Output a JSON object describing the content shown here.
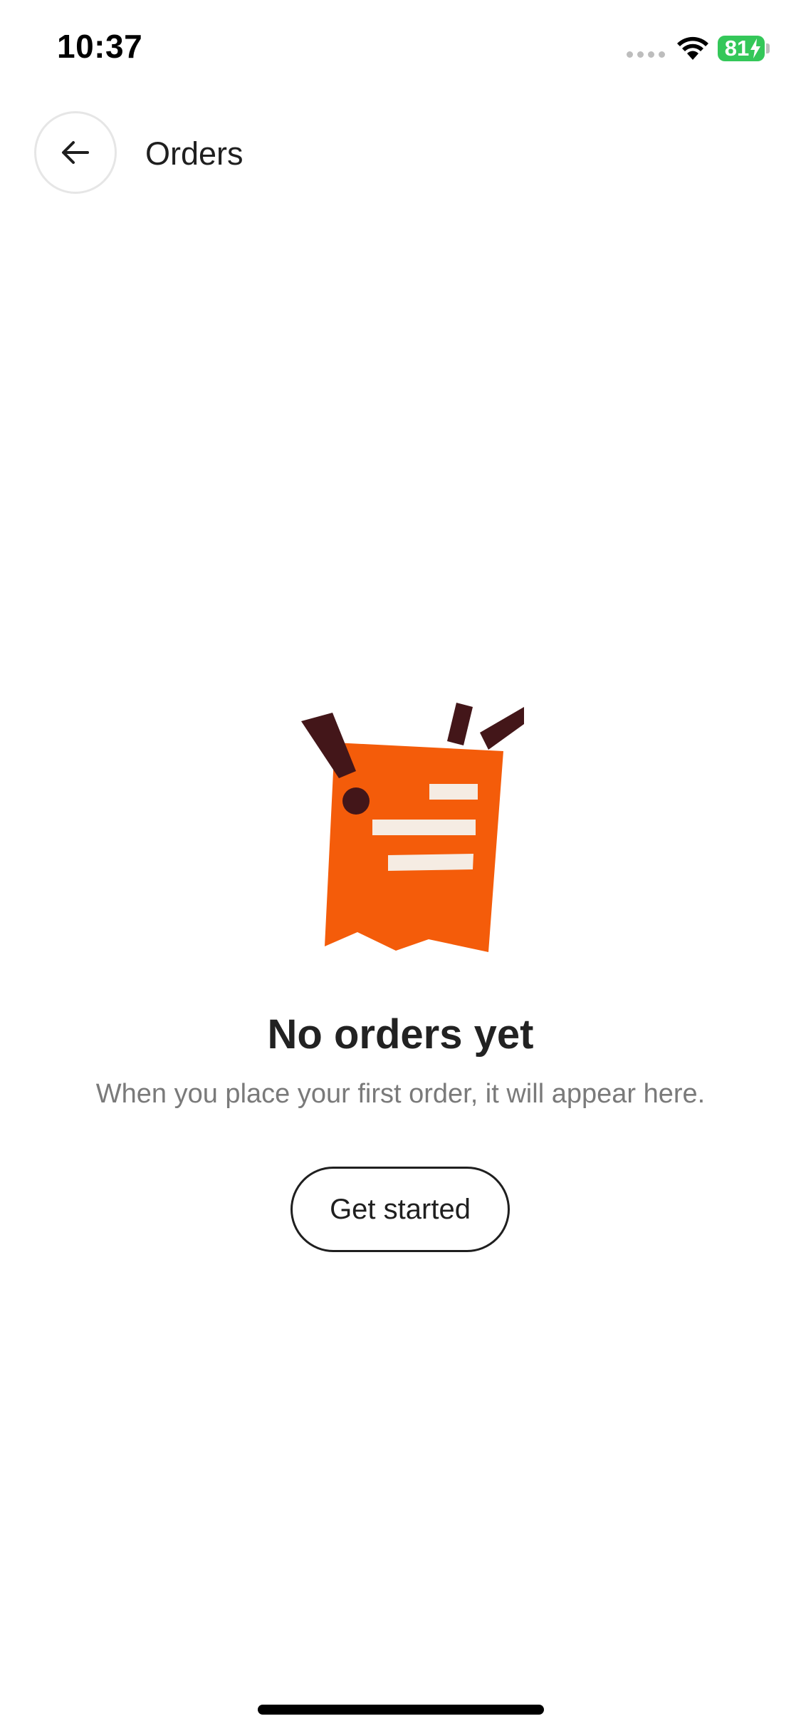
{
  "status_bar": {
    "time": "10:37",
    "battery_level": "81",
    "battery_color": "#34c759",
    "icons": [
      "signal-dots-icon",
      "wifi-icon",
      "battery-icon",
      "charging-icon"
    ]
  },
  "header": {
    "back_icon": "arrow-left-icon",
    "title": "Orders"
  },
  "empty_state": {
    "illustration": "receipt-illustration",
    "illustration_colors": {
      "receipt": "#f45c0a",
      "marks": "#431619",
      "lines": "#f5ece3"
    },
    "title": "No orders yet",
    "subtitle": "When you place your first order, it will appear here.",
    "button_label": "Get started"
  }
}
